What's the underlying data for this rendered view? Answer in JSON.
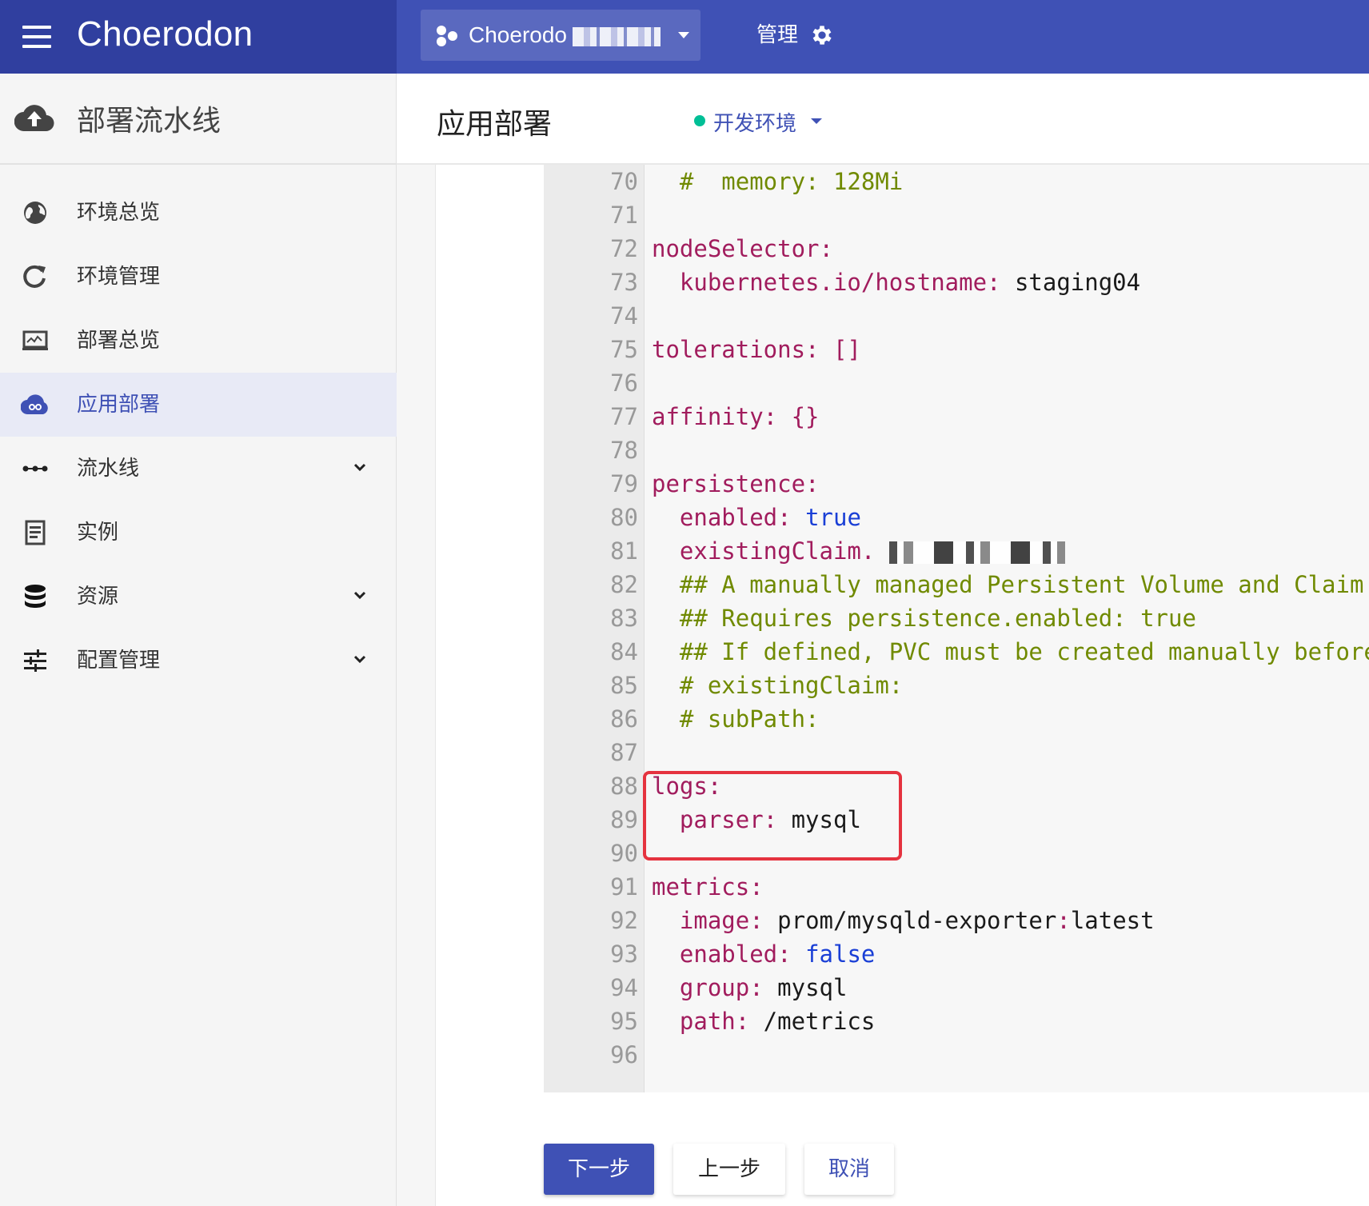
{
  "app": {
    "brand": "Choerodon"
  },
  "header": {
    "project_label": "Choerodo",
    "admin_label": "管理"
  },
  "sidebar": {
    "section_title": "部署流水线",
    "items": [
      {
        "label": "环境总览",
        "icon": "globe-icon",
        "expandable": false,
        "active": false
      },
      {
        "label": "环境管理",
        "icon": "refresh-icon",
        "expandable": false,
        "active": false
      },
      {
        "label": "部署总览",
        "icon": "monitor-icon",
        "expandable": false,
        "active": false
      },
      {
        "label": "应用部署",
        "icon": "cloud-link-icon",
        "expandable": false,
        "active": true
      },
      {
        "label": "流水线",
        "icon": "more-horizontal-icon",
        "expandable": true,
        "active": false
      },
      {
        "label": "实例",
        "icon": "document-icon",
        "expandable": false,
        "active": false
      },
      {
        "label": "资源",
        "icon": "database-icon",
        "expandable": true,
        "active": false
      },
      {
        "label": "配置管理",
        "icon": "sliders-icon",
        "expandable": true,
        "active": false
      }
    ]
  },
  "main": {
    "title": "应用部署",
    "environment": {
      "label": "开发环境",
      "status_color": "#00bf96"
    }
  },
  "editor": {
    "lines": [
      {
        "n": "70",
        "code": [
          {
            "t": "  #  memory: 128Mi",
            "c": "c"
          }
        ]
      },
      {
        "n": "71",
        "code": []
      },
      {
        "n": "72",
        "code": [
          {
            "t": "nodeSelector:",
            "c": "k"
          }
        ]
      },
      {
        "n": "73",
        "code": [
          {
            "t": "  kubernetes.io/hostname:",
            "c": "k"
          },
          {
            "t": " staging04",
            "c": "v"
          }
        ]
      },
      {
        "n": "74",
        "code": []
      },
      {
        "n": "75",
        "code": [
          {
            "t": "tolerations:",
            "c": "k"
          },
          {
            "t": " []",
            "c": "k"
          }
        ]
      },
      {
        "n": "76",
        "code": []
      },
      {
        "n": "77",
        "code": [
          {
            "t": "affinity:",
            "c": "k"
          },
          {
            "t": " {}",
            "c": "k"
          }
        ]
      },
      {
        "n": "78",
        "code": []
      },
      {
        "n": "79",
        "code": [
          {
            "t": "persistence:",
            "c": "k"
          }
        ]
      },
      {
        "n": "80",
        "code": [
          {
            "t": "  enabled:",
            "c": "k"
          },
          {
            "t": " true",
            "c": "b"
          }
        ]
      },
      {
        "n": "81",
        "code": [
          {
            "t": "  existingClaim.",
            "c": "k"
          }
        ],
        "masked": true
      },
      {
        "n": "82",
        "code": [
          {
            "t": "  ## A manually managed Persistent Volume and Claim",
            "c": "c"
          }
        ]
      },
      {
        "n": "83",
        "code": [
          {
            "t": "  ## Requires persistence.enabled: true",
            "c": "c"
          }
        ]
      },
      {
        "n": "84",
        "code": [
          {
            "t": "  ## If defined, PVC must be created manually before v",
            "c": "c"
          }
        ]
      },
      {
        "n": "85",
        "code": [
          {
            "t": "  # existingClaim:",
            "c": "c"
          }
        ]
      },
      {
        "n": "86",
        "code": [
          {
            "t": "  # subPath:",
            "c": "c"
          }
        ]
      },
      {
        "n": "87",
        "code": []
      },
      {
        "n": "88",
        "code": [
          {
            "t": "logs:",
            "c": "k"
          }
        ]
      },
      {
        "n": "89",
        "code": [
          {
            "t": "  parser:",
            "c": "k"
          },
          {
            "t": " mysql",
            "c": "v"
          }
        ]
      },
      {
        "n": "90",
        "code": []
      },
      {
        "n": "91",
        "code": [
          {
            "t": "metrics:",
            "c": "k"
          }
        ]
      },
      {
        "n": "92",
        "code": [
          {
            "t": "  image:",
            "c": "k"
          },
          {
            "t": " prom/mysqld-exporter",
            "c": "v"
          },
          {
            "t": ":",
            "c": "k"
          },
          {
            "t": "latest",
            "c": "v"
          }
        ]
      },
      {
        "n": "93",
        "code": [
          {
            "t": "  enabled:",
            "c": "k"
          },
          {
            "t": " false",
            "c": "b"
          }
        ]
      },
      {
        "n": "94",
        "code": [
          {
            "t": "  group:",
            "c": "k"
          },
          {
            "t": " mysql",
            "c": "v"
          }
        ]
      },
      {
        "n": "95",
        "code": [
          {
            "t": "  path:",
            "c": "k"
          },
          {
            "t": " /metrics",
            "c": "v"
          }
        ]
      },
      {
        "n": "96",
        "code": []
      }
    ]
  },
  "actions": {
    "next_label": "下一步",
    "prev_label": "上一步",
    "cancel_label": "取消"
  },
  "colors": {
    "primary": "#3f51b5",
    "primary_dark": "#303f9f",
    "highlight_border": "#e5333f"
  }
}
